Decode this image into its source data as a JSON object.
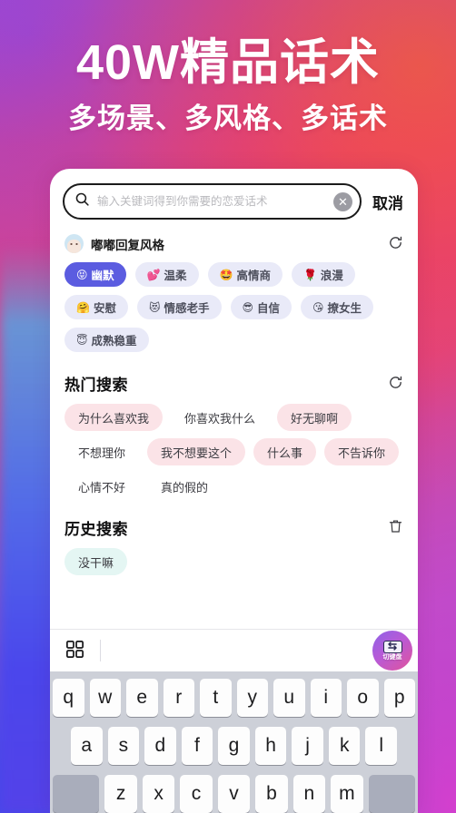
{
  "poster": {
    "headline": "40W精品话术",
    "subline": "多场景、多风格、多话术"
  },
  "colors": {
    "accent_purple": "#5b5ce0",
    "chip_bg": "#e9eaf8",
    "hot_tag_bg": "#fbe3e7",
    "history_tag_bg": "#e4f6f3",
    "keyboard_bg": "#cdd0d8",
    "key_bg": "#fdfdfd",
    "key_special_bg": "#a9adbb"
  },
  "search": {
    "icon": "search-icon",
    "placeholder": "输入关键词得到你需要的恋爱话术",
    "value": "",
    "clear_icon": "✕",
    "cancel_label": "取消"
  },
  "style_section": {
    "avatar": "avatar-duodu",
    "title": "嘟嘟回复风格",
    "refresh_icon": "refresh-icon",
    "chips": [
      {
        "emoji": "😝",
        "label": "幽默",
        "selected": true
      },
      {
        "emoji": "💕",
        "label": "温柔",
        "selected": false
      },
      {
        "emoji": "🤩",
        "label": "高情商",
        "selected": false
      },
      {
        "emoji": "🌹",
        "label": "浪漫",
        "selected": false
      },
      {
        "emoji": "🤗",
        "label": "安慰",
        "selected": false
      },
      {
        "emoji": "😻",
        "label": "情感老手",
        "selected": false
      },
      {
        "emoji": "😎",
        "label": "自信",
        "selected": false
      },
      {
        "emoji": "😘",
        "label": "撩女生",
        "selected": false
      },
      {
        "emoji": "😇",
        "label": "成熟稳重",
        "selected": false
      }
    ]
  },
  "hot_search": {
    "title": "热门搜索",
    "refresh_icon": "refresh-icon",
    "tags": [
      {
        "label": "为什么喜欢我",
        "filled": true
      },
      {
        "label": "你喜欢我什么",
        "filled": false
      },
      {
        "label": "好无聊啊",
        "filled": true
      },
      {
        "label": "不想理你",
        "filled": false
      },
      {
        "label": "我不想要这个",
        "filled": true
      },
      {
        "label": "什么事",
        "filled": true
      },
      {
        "label": "不告诉你",
        "filled": true
      },
      {
        "label": "心情不好",
        "filled": false
      },
      {
        "label": "真的假的",
        "filled": false
      }
    ]
  },
  "history_search": {
    "title": "历史搜索",
    "delete_icon": "trash-icon",
    "tags": [
      {
        "label": "没干嘛"
      }
    ]
  },
  "keyboard_toolbar": {
    "grid_icon": "grid-icon",
    "switch_badge": {
      "icon": "keyboard-switch-icon",
      "label": "切键盘"
    }
  },
  "keyboard": {
    "row1": [
      "q",
      "w",
      "e",
      "r",
      "t",
      "y",
      "u",
      "i",
      "o",
      "p"
    ],
    "row2": [
      "a",
      "s",
      "d",
      "f",
      "g",
      "h",
      "j",
      "k",
      "l"
    ],
    "row3": [
      "⇧",
      "z",
      "x",
      "c",
      "v",
      "b",
      "n",
      "m",
      "⌫"
    ]
  }
}
